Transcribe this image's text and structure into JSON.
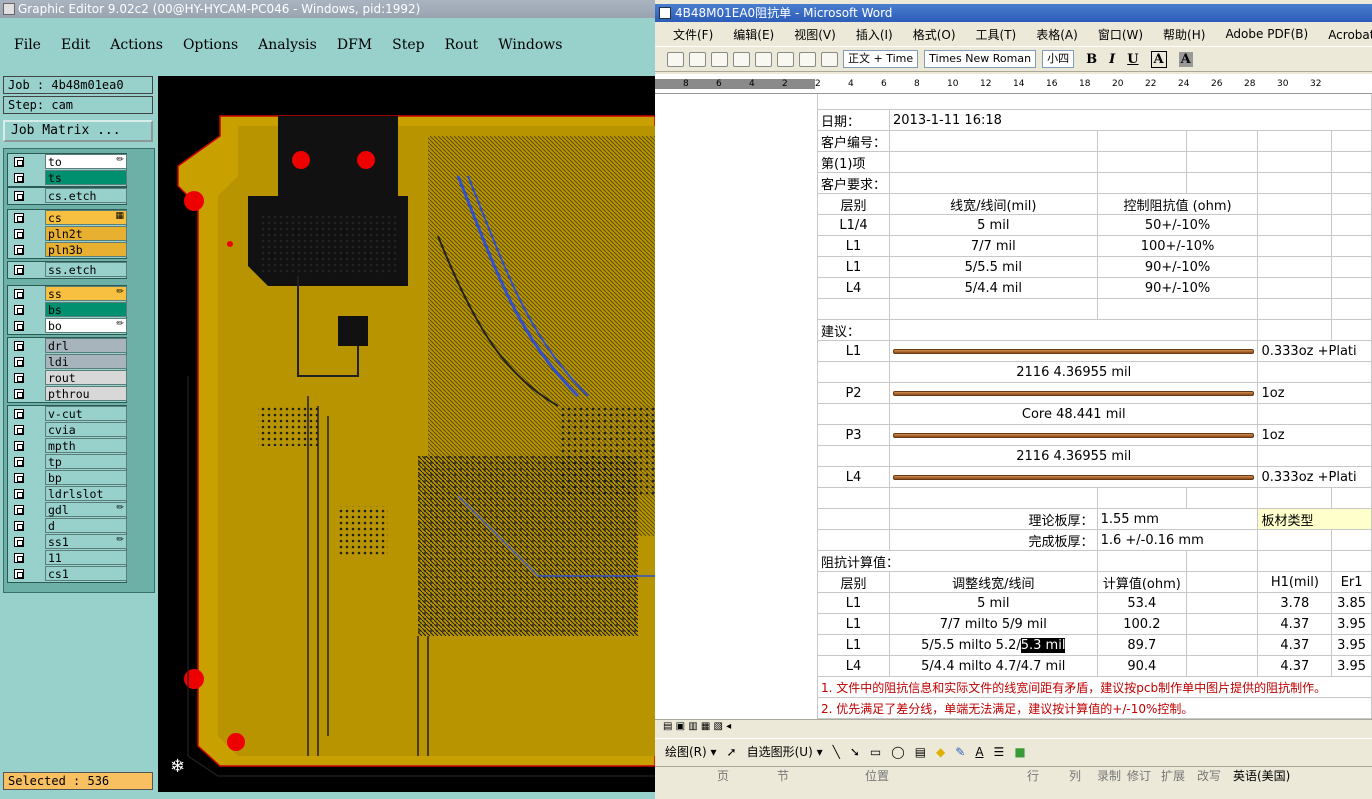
{
  "ge": {
    "title": "Graphic Editor 9.02c2 (00@HY-HYCAM-PC046 - Windows, pid:1992)",
    "menu": [
      "File",
      "Edit",
      "Actions",
      "Options",
      "Analysis",
      "DFM",
      "Step",
      "Rout",
      "Windows"
    ],
    "job": "Job : 4b48m01ea0",
    "step": "Step: cam",
    "job_matrix": "Job Matrix ...",
    "selected": "Selected : 536",
    "layer_groups": [
      [
        {
          "name": "to",
          "color": "#ffffff",
          "mark": "✏"
        },
        {
          "name": "ts",
          "color": "#009070",
          "mark": ""
        }
      ],
      [
        {
          "name": "cs.etch",
          "color": "#98d0cc",
          "mark": ""
        }
      ],
      [
        {
          "name": "cs",
          "color": "#f8c040",
          "mark": "▦"
        },
        {
          "name": "pln2t",
          "color": "#e8b030",
          "mark": ""
        },
        {
          "name": "pln3b",
          "color": "#e8b030",
          "mark": ""
        }
      ],
      [
        {
          "name": "ss.etch",
          "color": "#98d0cc",
          "mark": ""
        }
      ],
      [
        {
          "name": "ss",
          "color": "#f8c040",
          "mark": "✏"
        },
        {
          "name": "bs",
          "color": "#009070",
          "mark": ""
        },
        {
          "name": "bo",
          "color": "#ffffff",
          "mark": "✏"
        }
      ],
      [
        {
          "name": "drl",
          "color": "#a8b4bc",
          "mark": ""
        },
        {
          "name": "ldi",
          "color": "#a8b4bc",
          "mark": ""
        },
        {
          "name": "rout",
          "color": "#d8d8d8",
          "mark": ""
        },
        {
          "name": "pthrou",
          "color": "#d8d8d8",
          "mark": ""
        }
      ],
      [
        {
          "name": "v-cut",
          "color": "#98d0cc",
          "mark": ""
        },
        {
          "name": "cvia",
          "color": "#98d0cc",
          "mark": ""
        },
        {
          "name": "mpth",
          "color": "#98d0cc",
          "mark": ""
        },
        {
          "name": "tp",
          "color": "#98d0cc",
          "mark": ""
        },
        {
          "name": "bp",
          "color": "#98d0cc",
          "mark": ""
        },
        {
          "name": "ldrlslot",
          "color": "#98d0cc",
          "mark": ""
        },
        {
          "name": "gdl",
          "color": "#98d0cc",
          "mark": "✏"
        },
        {
          "name": "d",
          "color": "#98d0cc",
          "mark": ""
        },
        {
          "name": "ss1",
          "color": "#98d0cc",
          "mark": "✏"
        },
        {
          "name": "11",
          "color": "#98d0cc",
          "mark": ""
        },
        {
          "name": "cs1",
          "color": "#98d0cc",
          "mark": ""
        }
      ]
    ]
  },
  "wd": {
    "title": "4B48M01EA0阻抗单 - Microsoft Word",
    "menu": [
      "文件(F)",
      "编辑(E)",
      "视图(V)",
      "插入(I)",
      "格式(O)",
      "工具(T)",
      "表格(A)",
      "窗口(W)",
      "帮助(H)",
      "Adobe PDF(B)",
      "Acrobat 注释(C)"
    ],
    "style": "正文 + Time",
    "font": "Times New Roman",
    "size": "小四",
    "ruler": [
      "8",
      "6",
      "4",
      "2",
      "2",
      "4",
      "6",
      "8",
      "10",
      "12",
      "14",
      "16",
      "18",
      "20",
      "22",
      "24",
      "26",
      "28",
      "30",
      "32"
    ],
    "draw": "绘图(R) ▾",
    "autoshape": "自选图形(U) ▾",
    "status": [
      "页",
      "节",
      "位置",
      "行",
      "列",
      "录制",
      "修订",
      "扩展",
      "改写",
      "英语(美国)"
    ],
    "doc": {
      "date_label": "日期：",
      "date": "2013-1-11 16:18",
      "cust_no": "客户编号：",
      "item": "第(1)项",
      "cust_req": "客户要求：",
      "req_head": [
        "层别",
        "线宽/线间(mil)",
        "控制阻抗值 (ohm)"
      ],
      "req_rows": [
        [
          "L1/4",
          "5 mil",
          "50+/-10%"
        ],
        [
          "L1",
          "7/7 mil",
          "100+/-10%"
        ],
        [
          "L1",
          "5/5.5 mil",
          "90+/-10%"
        ],
        [
          "L4",
          "5/4.4 mil",
          "90+/-10%"
        ]
      ],
      "suggest": "建议：",
      "stack": [
        {
          "layer": "L1",
          "copper": true,
          "right": "0.333oz +Plati"
        },
        {
          "layer": "",
          "mid": "2116    4.36955 mil",
          "right": ""
        },
        {
          "layer": "P2",
          "copper": true,
          "right": "1oz"
        },
        {
          "layer": "",
          "mid": "Core   48.441 mil",
          "right": ""
        },
        {
          "layer": "P3",
          "copper": true,
          "right": "1oz"
        },
        {
          "layer": "",
          "mid": "2116    4.36955 mil",
          "right": ""
        },
        {
          "layer": "L4",
          "copper": true,
          "right": "0.333oz +Plati"
        }
      ],
      "thick_theory_label": "理论板厚：",
      "thick_theory": "1.55 mm",
      "board_type_label": "板材类型",
      "thick_finish_label": "完成板厚：",
      "thick_finish": "1.6 +/-0.16 mm",
      "calc_label": "阻抗计算值：",
      "calc_head": [
        "层别",
        "调整线宽/线间",
        "计算值(ohm)",
        "",
        "H1(mil)",
        "Er1"
      ],
      "calc_rows": [
        [
          "L1",
          "5 mil",
          "53.4",
          "",
          "3.78",
          "3.85"
        ],
        [
          "L1",
          "7/7 milto 5/9 mil",
          "100.2",
          "",
          "4.37",
          "3.95"
        ],
        [
          "L1",
          "5/5.5 milto 5.2/",
          "89.7",
          "",
          "4.37",
          "3.95"
        ],
        [
          "L4",
          "5/4.4 milto 4.7/4.7 mil",
          "90.4",
          "",
          "4.37",
          "3.95"
        ]
      ],
      "calc_hl": "5.3 mil",
      "note1": "1. 文件中的阻抗信息和实际文件的线宽间距有矛盾，建议按pcb制作单中图片提供的阻抗制作。",
      "note2": "2. 优先满足了差分线，单端无法满足，建议按计算值的+/-10%控制。"
    }
  }
}
